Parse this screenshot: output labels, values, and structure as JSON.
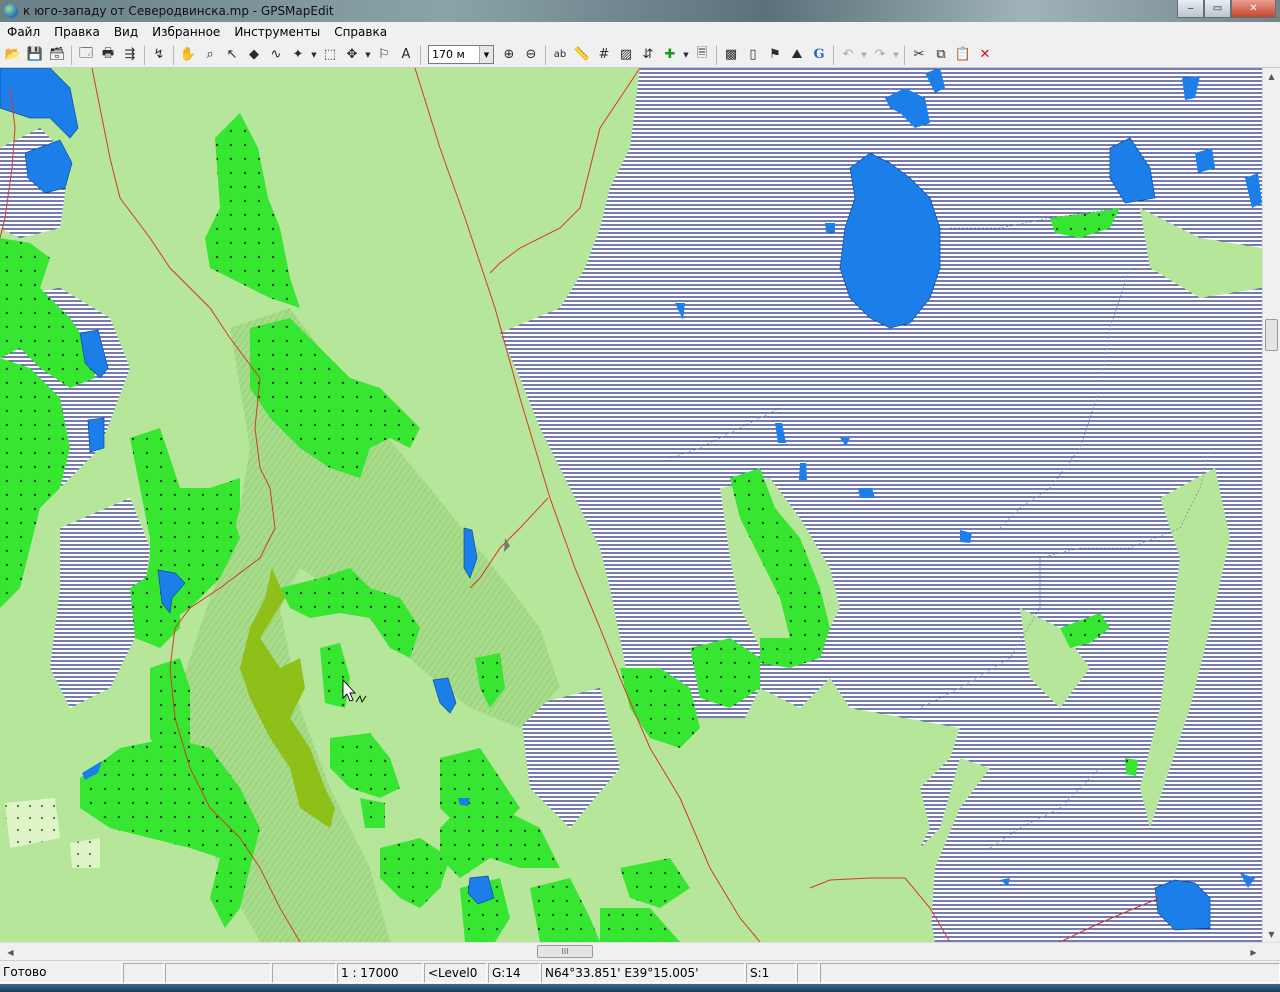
{
  "window": {
    "title": "к юго-западу от Северодвинска.mp - GPSMapEdit",
    "minimize_label": "‒",
    "maximize_label": "▭",
    "close_label": "✕"
  },
  "menu": {
    "items": [
      "Файл",
      "Правка",
      "Вид",
      "Избранное",
      "Инструменты",
      "Справка"
    ]
  },
  "toolbar": {
    "zoom_value": "170 м",
    "zoom_options": [
      "170 м"
    ]
  },
  "map": {
    "colors": {
      "forest": "#b6e69a",
      "dense_forest": "#36e630",
      "water": "#1c7ee8",
      "swamp_lines": "#1a237e",
      "road": "#d63a2a",
      "grass": "#8fc01a"
    }
  },
  "scrollbar": {
    "grip": "III"
  },
  "status": {
    "state": "Готово",
    "scale": "1 : 17000",
    "level": "<Level0",
    "grid": "G:14",
    "coords": "N64°33.851' E39°15.005'",
    "selection": "S:1"
  }
}
